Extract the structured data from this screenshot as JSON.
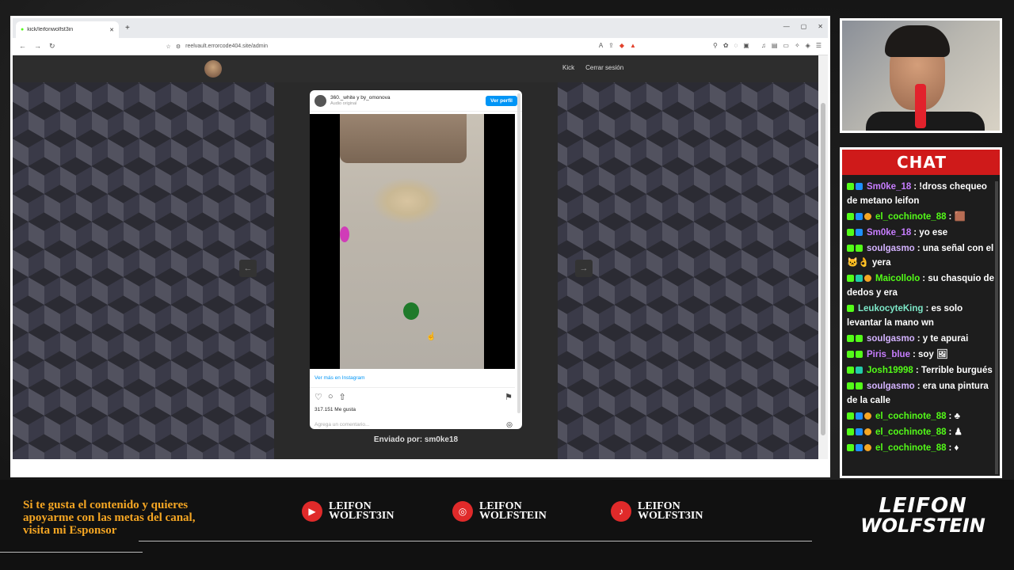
{
  "browser": {
    "tab_title": "kick/leifonwolfst3in",
    "url": "reelvault.errorcode404.site/admin"
  },
  "site": {
    "nav": {
      "kick_label": "Kick",
      "logout_label": "Cerrar sesión"
    },
    "prev_arrow": "←",
    "next_arrow": "→"
  },
  "instagram": {
    "users": "360._white y by_omonova",
    "audio": "Audio original",
    "view_profile": "Ver perfil",
    "more_link": "Ver más en Instagram",
    "likes": "317.151 Me gusta",
    "comment_placeholder": "Agrega un comentario..."
  },
  "sent_by": "Enviado por: sm0ke18",
  "chat": {
    "title": "CHAT",
    "messages": [
      {
        "user": "Sm0ke_18",
        "color": "#c77dff",
        "text": ": !dross chequeo de metano leifon",
        "badges": [
          "b-g",
          "b-b"
        ]
      },
      {
        "user": "el_cochinote_88",
        "color": "#53fc18",
        "text": ": 🟫",
        "badges": [
          "b-g",
          "b-b",
          "b-o"
        ]
      },
      {
        "user": "Sm0ke_18",
        "color": "#c77dff",
        "text": ": yo ese",
        "badges": [
          "b-g",
          "b-b"
        ]
      },
      {
        "user": "soulgasmo",
        "color": "#d4b3ff",
        "text": ": una señal con el 🐱👌 yera",
        "badges": [
          "b-g",
          "b-g"
        ]
      },
      {
        "user": "Maicollolo",
        "color": "#53fc18",
        "text": ": su chasquio de dedos y era",
        "badges": [
          "b-g",
          "b-c",
          "b-o"
        ]
      },
      {
        "user": "LeukocyteKing",
        "color": "#7de8c8",
        "text": ": es solo levantar la mano wn",
        "badges": [
          "b-g"
        ]
      },
      {
        "user": "soulgasmo",
        "color": "#d4b3ff",
        "text": ": y te apurai",
        "badges": [
          "b-g",
          "b-g"
        ]
      },
      {
        "user": "Piris_blue",
        "color": "#c77dff",
        "text": ": soy 🖼",
        "badges": [
          "b-g",
          "b-g"
        ]
      },
      {
        "user": "Josh19998",
        "color": "#53fc18",
        "text": ": Terrible burgués",
        "badges": [
          "b-g",
          "b-c"
        ]
      },
      {
        "user": "soulgasmo",
        "color": "#d4b3ff",
        "text": ": era una pintura de la calle",
        "badges": [
          "b-g",
          "b-g"
        ]
      },
      {
        "user": "el_cochinote_88",
        "color": "#53fc18",
        "text": ": ♣",
        "badges": [
          "b-g",
          "b-b",
          "b-o"
        ]
      },
      {
        "user": "el_cochinote_88",
        "color": "#53fc18",
        "text": ": ♟",
        "badges": [
          "b-g",
          "b-b",
          "b-o"
        ]
      },
      {
        "user": "el_cochinote_88",
        "color": "#53fc18",
        "text": ": ♦",
        "badges": [
          "b-g",
          "b-b",
          "b-o"
        ]
      }
    ]
  },
  "footer": {
    "sponsor_lines": [
      "Si te gusta el contenido y quieres",
      "apoyarme con las metas del canal,",
      "visita mi Esponsor"
    ],
    "youtube": {
      "icon": "youtube-icon",
      "l1": "LEIFON",
      "l2": "WOLFST3IN"
    },
    "instagram": {
      "icon": "instagram-icon",
      "l1": "LEIFON",
      "l2": "WOLFSTEIN"
    },
    "tiktok": {
      "icon": "tiktok-icon",
      "l1": "LEIFON",
      "l2": "WOLFST3IN"
    },
    "logo_l1": "LEIFON",
    "logo_l2": "WOLFSTEIN"
  }
}
